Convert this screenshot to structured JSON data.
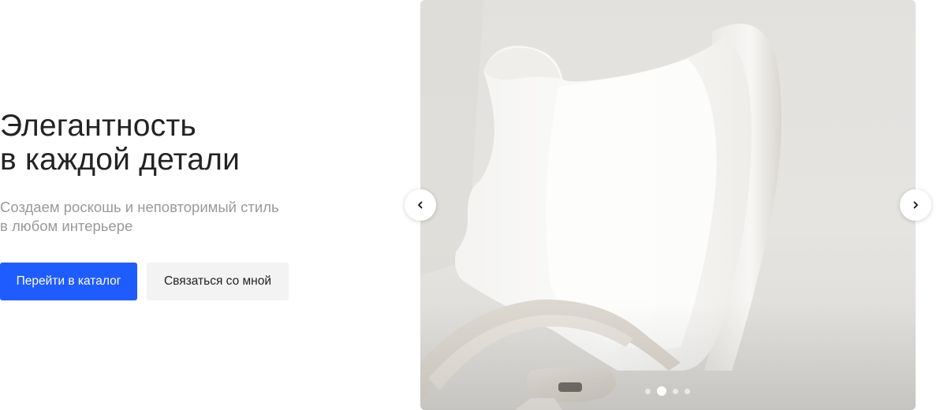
{
  "hero": {
    "title_line1": "Элегантность",
    "title_line2": "в каждой детали",
    "subtitle_line1": "Создаем роскошь и неповторимый стиль",
    "subtitle_line2": "в любом интерьере",
    "primary_button": "Перейти в каталог",
    "secondary_button": "Связаться со мной"
  },
  "slider": {
    "prev_icon": "chevron-left-icon",
    "next_icon": "chevron-right-icon",
    "slide_count": 4,
    "active_slide": 2,
    "image_subject": "white sculptural chair"
  },
  "colors": {
    "accent": "#1f5cff",
    "title": "#232323",
    "subtitle": "#9a9a9a",
    "secondary_button_bg": "#f3f3f3"
  }
}
